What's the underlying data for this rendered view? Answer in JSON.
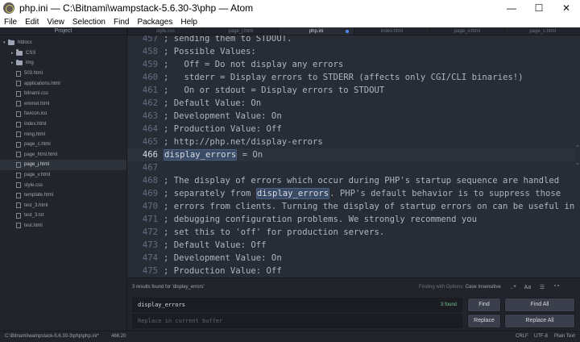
{
  "window": {
    "title": "php.ini — C:\\Bitnami\\wampstack-5.6.30-3\\php — Atom",
    "minimize": "—",
    "maximize": "☐",
    "close": "✕"
  },
  "menu": [
    "File",
    "Edit",
    "View",
    "Selection",
    "Find",
    "Packages",
    "Help"
  ],
  "tree": {
    "header": "Project",
    "root": "htdocs",
    "folders": [
      "CSS",
      "img"
    ],
    "files": [
      "503.html",
      "applications.html",
      "bitnami.css",
      "emmet.html",
      "favicon.ico",
      "index.html",
      "ming.html",
      "page_c.html",
      "page_html.html",
      "page_j.html",
      "page_v.html",
      "style.css",
      "template.html",
      "test_3.html",
      "test_3.txt",
      "test.html"
    ],
    "selected": "page_j.html"
  },
  "tabs": [
    {
      "label": "style.css",
      "active": false
    },
    {
      "label": "page_j.html",
      "active": false
    },
    {
      "label": "php.ini",
      "active": true,
      "modified": true
    },
    {
      "label": "index.html",
      "active": false
    },
    {
      "label": "page_v.html",
      "active": false
    },
    {
      "label": "page_c.html",
      "active": false
    }
  ],
  "editor": {
    "lines": [
      {
        "num": "457",
        "text": "; sending them to STDOUT."
      },
      {
        "num": "458",
        "text": "; Possible Values:"
      },
      {
        "num": "459",
        "text": ";   Off = Do not display any errors"
      },
      {
        "num": "460",
        "text": ";   stderr = Display errors to STDERR (affects only CGI/CLI binaries!)"
      },
      {
        "num": "461",
        "text": ";   On or stdout = Display errors to STDOUT"
      },
      {
        "num": "462",
        "text": "; Default Value: On"
      },
      {
        "num": "463",
        "text": "; Development Value: On"
      },
      {
        "num": "464",
        "text": "; Production Value: Off"
      },
      {
        "num": "465",
        "text": "; http://php.net/display-errors"
      },
      {
        "num": "466",
        "pre": "",
        "match": "display_errors",
        "post": " = On",
        "cursor": true
      },
      {
        "num": "467",
        "text": ""
      },
      {
        "num": "468",
        "text": "; The display of errors which occur during PHP's startup sequence are handled"
      },
      {
        "num": "469",
        "pre": "; separately from ",
        "match": "display_errors",
        "post": ". PHP's default behavior is to suppress those"
      },
      {
        "num": "470",
        "text": "; errors from clients. Turning the display of startup errors on can be useful in"
      },
      {
        "num": "471",
        "text": "; debugging configuration problems. We strongly recommend you"
      },
      {
        "num": "472",
        "text": "; set this to 'off' for production servers."
      },
      {
        "num": "473",
        "text": "; Default Value: Off"
      },
      {
        "num": "474",
        "text": "; Development Value: On"
      },
      {
        "num": "475",
        "text": "; Production Value: Off"
      }
    ]
  },
  "find": {
    "results_text": "3 results found for 'display_errors'",
    "options_prefix": "Finding with Options:",
    "options_value": "Case Insensitive",
    "find_value": "display_errors",
    "found_count": "3 found",
    "replace_placeholder": "Replace in current buffer",
    "find_button": "Find",
    "find_all_button": "Find All",
    "replace_button": "Replace",
    "replace_all_button": "Replace All",
    "option_regex": ".*",
    "option_case": "Aa",
    "option_selection": "☰",
    "option_word": "\"\""
  },
  "status": {
    "path": "C:\\Bitnami\\wampstack-5.6.30-3\\php\\php.ini*",
    "cursor": "466:20",
    "line_ending": "CRLF",
    "encoding": "UTF-8",
    "grammar": "Plain Text"
  },
  "colors": {
    "editor_bg": "#282c34",
    "panel_bg": "#21252b",
    "match_highlight": "#3a4b66",
    "accent": "#528bff",
    "found": "#73c990"
  }
}
